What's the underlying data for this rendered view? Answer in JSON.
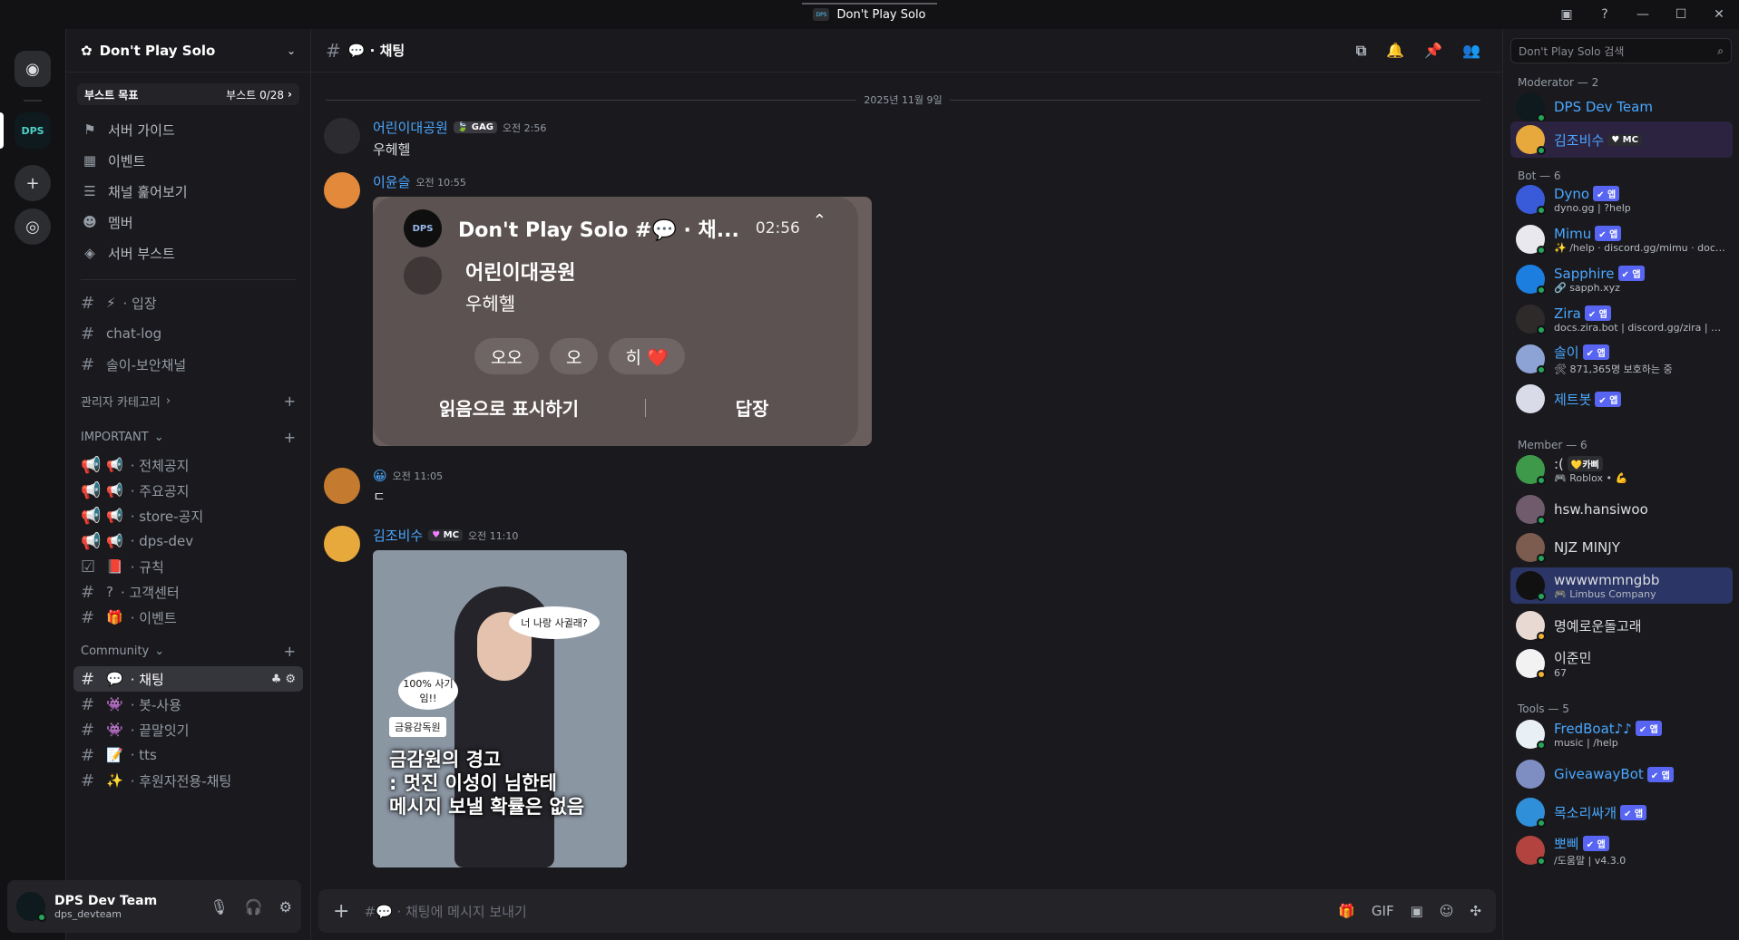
{
  "window": {
    "title": "Don't Play Solo",
    "logo_text": "DPS"
  },
  "rail": {
    "server_label": "DPS"
  },
  "guild": {
    "name": "Don't Play Solo"
  },
  "boost": {
    "label": "부스트 목표",
    "progress": "부스트 0/28"
  },
  "nav": [
    "서버 가이드",
    "이벤트",
    "채널 훑어보기",
    "멤버",
    "서버 부스트"
  ],
  "top_channels": [
    {
      "emoji": "⚡",
      "name": "· 입장"
    },
    {
      "emoji": "",
      "name": "chat-log"
    },
    {
      "emoji": "",
      "name": "솔이-보안채널"
    }
  ],
  "categories": {
    "admin": "관리자 카테고리",
    "important": "IMPORTANT",
    "community": "Community"
  },
  "important_channels": [
    {
      "emoji": "📢",
      "name": "· 전체공지"
    },
    {
      "emoji": "📢",
      "name": "· 주요공지"
    },
    {
      "emoji": "📢",
      "name": "· store-공지"
    },
    {
      "emoji": "📢",
      "name": "· dps-dev"
    },
    {
      "emoji": "📕",
      "name": "· 규칙"
    },
    {
      "emoji": "?",
      "name": "· 고객센터"
    },
    {
      "emoji": "🎁",
      "name": "· 이벤트"
    }
  ],
  "community_channels": [
    {
      "emoji": "💬",
      "name": "· 채팅",
      "active": true
    },
    {
      "emoji": "👾",
      "name": "· 봇-사용"
    },
    {
      "emoji": "👾",
      "name": "· 끝말잇기"
    },
    {
      "emoji": "📝",
      "name": "· tts"
    },
    {
      "emoji": "✨",
      "name": "· 후원자전용-채팅"
    }
  ],
  "user": {
    "name": "DPS Dev Team",
    "tag": "dps_devteam"
  },
  "channel": {
    "title": "💬 · 채팅"
  },
  "date_separator": "2025년 11월 9일",
  "messages": {
    "m1": {
      "user": "어린이대공원",
      "badge": "GAG",
      "time": "오전 2:56",
      "text": "우헤헬"
    },
    "m2": {
      "user": "이윤슬",
      "time": "오전 10:55"
    },
    "m3": {
      "user": "😀",
      "time": "오전 11:05",
      "text": "ㄷ"
    },
    "m4": {
      "user": "김조비수",
      "badge": "MC",
      "time": "오전 11:10"
    }
  },
  "embed": {
    "title": "Don't Play Solo #💬 · 채...",
    "time": "02:56",
    "author": "어린이대공원",
    "text": "우헤헬",
    "reactions": [
      "오오",
      "오",
      "히 ❤️"
    ],
    "mark_read": "읽음으로 표시하기",
    "reply": "답장"
  },
  "photo": {
    "bubble1": "너 나랑 사귈래?",
    "bubble2": "100% 사기임!!",
    "fss": "금융감독원",
    "caption1": "금감원의 경고",
    "caption2": ": 멋진 이성이 님한테",
    "caption3": "메시지 보낼 확률은 없음"
  },
  "composer": {
    "placeholder": "#💬 · 채팅에 메시지 보내기"
  },
  "search": {
    "placeholder": "Don't Play Solo 검색"
  },
  "members": {
    "moderator_header": "Moderator — 2",
    "bot_header": "Bot — 6",
    "member_header": "Member — 6",
    "tools_header": "Tools — 5",
    "moderators": [
      {
        "name": "DPS Dev Team",
        "status": ""
      },
      {
        "name": "김조비수",
        "badge": "MC",
        "status": ""
      }
    ],
    "bots": [
      {
        "name": "Dyno",
        "status": "dyno.gg | ?help"
      },
      {
        "name": "Mimu",
        "status": "✨ /help · discord.gg/mimu · docs...."
      },
      {
        "name": "Sapphire",
        "status": "🔗 sapph.xyz"
      },
      {
        "name": "Zira",
        "status": "docs.zira.bot | discord.gg/zira | Clu..."
      },
      {
        "name": "솔이",
        "status": "🛠 871,365명 보호하는 중"
      },
      {
        "name": "제트봇",
        "status": ""
      }
    ],
    "people": [
      {
        "name": ":(",
        "badge": "💛카삐",
        "status": "🎮 Roblox • 💪"
      },
      {
        "name": "hsw.hansiwoo",
        "status": ""
      },
      {
        "name": "NJZ MINJY",
        "status": ""
      },
      {
        "name": "wwwwmmngbb",
        "status": "🎮 Limbus Company"
      },
      {
        "name": "명예로운돌고래",
        "status": ""
      },
      {
        "name": "이준민",
        "status": "67"
      }
    ],
    "tools": [
      {
        "name": "FredBoat♪♪",
        "status": "music | /help"
      },
      {
        "name": "GiveawayBot",
        "status": ""
      },
      {
        "name": "목소리싸개",
        "status": ""
      },
      {
        "name": "뽀삐",
        "status": "/도움말 | v4.3.0"
      }
    ],
    "app_label": "✔ 앱"
  }
}
